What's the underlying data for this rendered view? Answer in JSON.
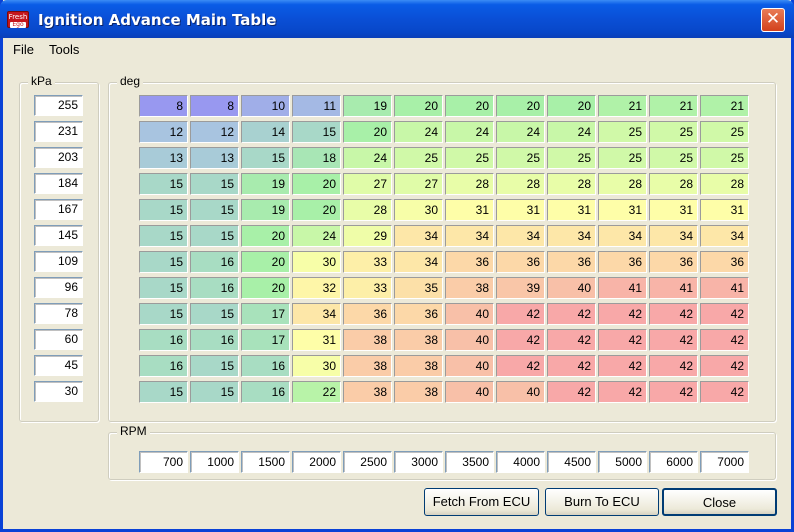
{
  "window": {
    "title": "Ignition Advance Main Table",
    "icon": "megasquirt-app-icon",
    "close_glyph": "✕"
  },
  "menu": [
    "File",
    "Tools"
  ],
  "kpa_group": {
    "label": "kPa",
    "values": [
      "255",
      "231",
      "203",
      "184",
      "167",
      "145",
      "109",
      "96",
      "78",
      "60",
      "45",
      "30"
    ]
  },
  "deg_group": {
    "label": "deg",
    "rows": [
      [
        "8",
        "8",
        "10",
        "11",
        "19",
        "20",
        "20",
        "20",
        "20",
        "21",
        "21",
        "21"
      ],
      [
        "12",
        "12",
        "14",
        "15",
        "20",
        "24",
        "24",
        "24",
        "24",
        "25",
        "25",
        "25"
      ],
      [
        "13",
        "13",
        "15",
        "18",
        "24",
        "25",
        "25",
        "25",
        "25",
        "25",
        "25",
        "25"
      ],
      [
        "15",
        "15",
        "19",
        "20",
        "27",
        "27",
        "28",
        "28",
        "28",
        "28",
        "28",
        "28"
      ],
      [
        "15",
        "15",
        "19",
        "20",
        "28",
        "30",
        "31",
        "31",
        "31",
        "31",
        "31",
        "31"
      ],
      [
        "15",
        "15",
        "20",
        "24",
        "29",
        "34",
        "34",
        "34",
        "34",
        "34",
        "34",
        "34"
      ],
      [
        "15",
        "16",
        "20",
        "30",
        "33",
        "34",
        "36",
        "36",
        "36",
        "36",
        "36",
        "36"
      ],
      [
        "15",
        "16",
        "20",
        "32",
        "33",
        "35",
        "38",
        "39",
        "40",
        "41",
        "41",
        "41"
      ],
      [
        "15",
        "15",
        "17",
        "34",
        "36",
        "36",
        "40",
        "42",
        "42",
        "42",
        "42",
        "42"
      ],
      [
        "16",
        "16",
        "17",
        "31",
        "38",
        "38",
        "40",
        "42",
        "42",
        "42",
        "42",
        "42"
      ],
      [
        "16",
        "15",
        "16",
        "30",
        "38",
        "38",
        "40",
        "42",
        "42",
        "42",
        "42",
        "42"
      ],
      [
        "15",
        "15",
        "16",
        "22",
        "38",
        "38",
        "40",
        "40",
        "42",
        "42",
        "42",
        "42"
      ]
    ]
  },
  "rpm_group": {
    "label": "RPM",
    "values": [
      "700",
      "1000",
      "1500",
      "2000",
      "2500",
      "3000",
      "3500",
      "4000",
      "4500",
      "5000",
      "6000",
      "7000"
    ]
  },
  "buttons": {
    "fetch": "Fetch From ECU",
    "burn": "Burn To ECU",
    "close": "Close"
  },
  "colors": {
    "title_bar": "#0a4fd6",
    "window_bg": "#ece9d8",
    "cell_low": "#9898f0",
    "cell_mid_low": "#a8d4c8",
    "cell_green": "#a8f0a8",
    "cell_yellow": "#fefea8",
    "cell_orange": "#f8c8a0",
    "cell_high": "#f8a0a0"
  }
}
